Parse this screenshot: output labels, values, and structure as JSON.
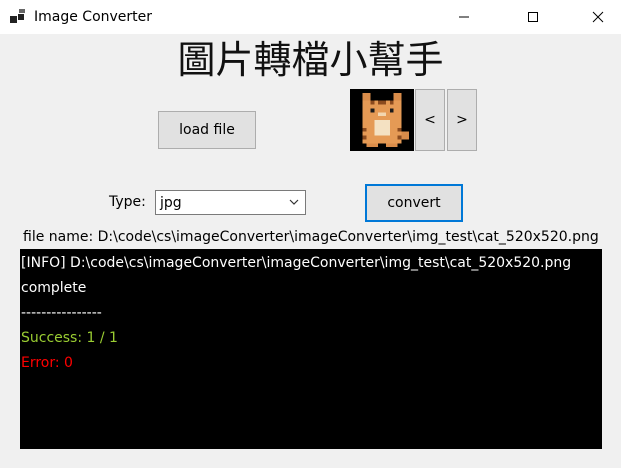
{
  "window": {
    "title": "Image Converter",
    "icon": "app-icon",
    "controls": [
      "minimize-icon",
      "maximize-icon",
      "close-icon"
    ]
  },
  "header": {
    "title": "圖片轉檔小幫手"
  },
  "toolbar": {
    "load_label": "load file",
    "prev_label": "<",
    "next_label": ">"
  },
  "preview": {
    "icon": "pixel-cat-image"
  },
  "type": {
    "label": "Type:",
    "selected": "jpg",
    "icon": "chevron-down-icon"
  },
  "convert": {
    "label": "convert"
  },
  "file": {
    "label": "file name: D:\\code\\cs\\imageConverter\\imageConverter\\img_test\\cat_520x520.png"
  },
  "console": {
    "background": "#000000",
    "lines": [
      {
        "text": "[INFO] D:\\code\\cs\\imageConverter\\imageConverter\\img_test\\cat_520x520.png",
        "color": "#ffffff"
      },
      {
        "text": "complete",
        "color": "#ffffff"
      },
      {
        "text": "----------------",
        "color": "#ffffff"
      },
      {
        "text": "Success: 1 / 1",
        "color": "#9acd32"
      },
      {
        "text": "Error: 0",
        "color": "#ff0000"
      }
    ]
  },
  "colors": {
    "accent": "#0078d7",
    "window_bg": "#f0f0f0"
  }
}
